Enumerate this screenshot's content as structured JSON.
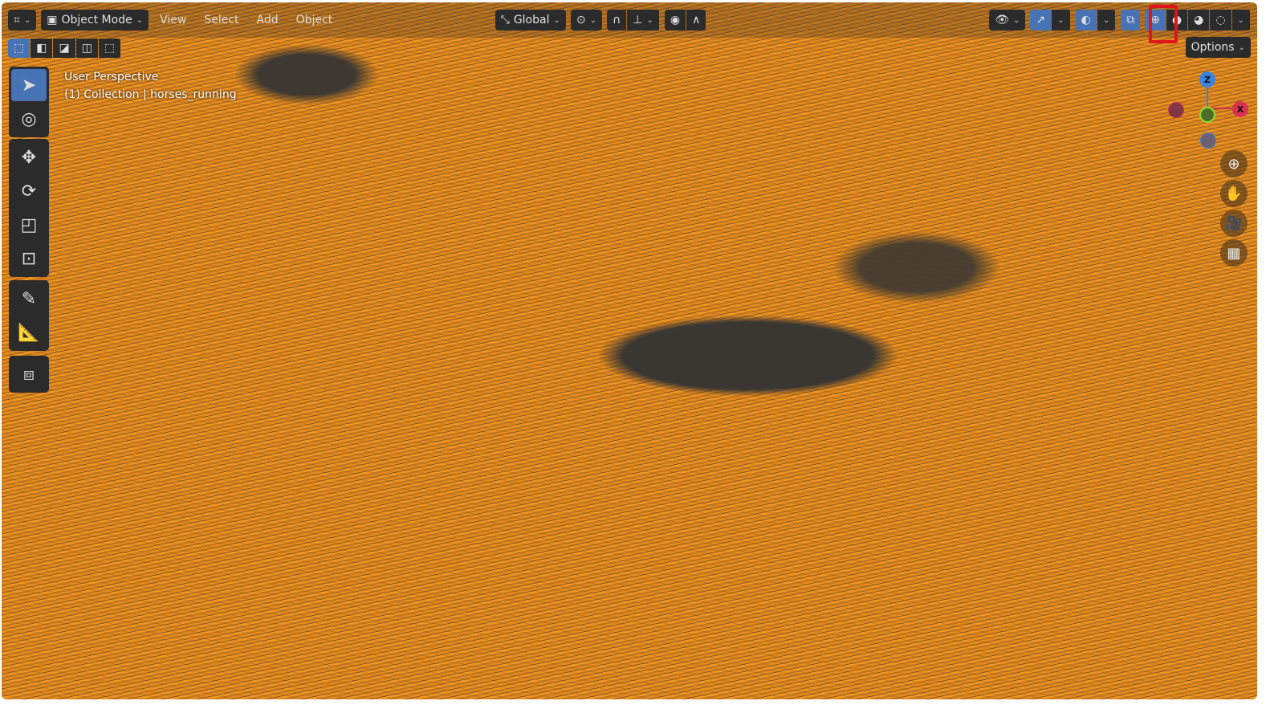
{
  "header": {
    "editor_type_icon": "viewport-icon",
    "mode": "Object Mode",
    "menus": [
      "View",
      "Select",
      "Add",
      "Object"
    ],
    "transform_orientation": "Global",
    "options_label": "Options"
  },
  "toolbar": {
    "tools": [
      "select-box",
      "cursor",
      "move",
      "rotate",
      "scale",
      "transform",
      "annotate",
      "measure",
      "add-cube"
    ],
    "active": "select-box"
  },
  "viewport": {
    "perspective": "User Perspective",
    "collection": "(1) Collection",
    "object": "horses_running",
    "shading": "wireframe",
    "highlight_color": "#e0141a"
  },
  "gizmo": {
    "z": "Z",
    "y": "Y",
    "x": "X"
  }
}
